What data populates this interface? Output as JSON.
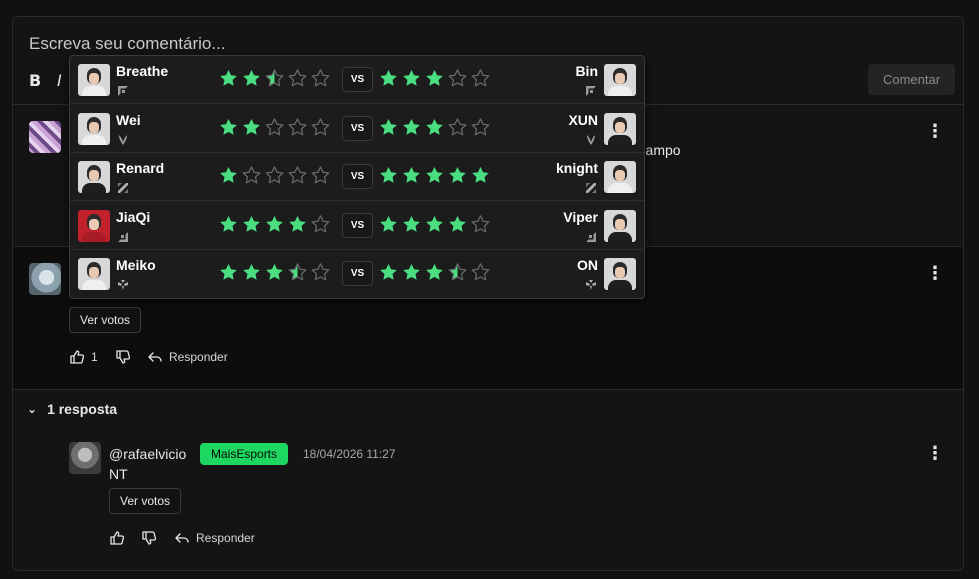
{
  "composer": {
    "placeholder": "Escreva seu comentário...",
    "bold_label": "B",
    "italic_label": "I",
    "submit_label": "Comentar"
  },
  "comments": [
    {
      "text_fragment": "m campo"
    },
    {
      "votes_label": "Ver votos",
      "likes": "1",
      "reply_label": "Responder"
    }
  ],
  "replies": {
    "toggle_label": "1 resposta",
    "items": [
      {
        "user": "@rafaelvicio",
        "badge": "MaisEsports",
        "timestamp": "18/04/2026 11:27",
        "text": "NT",
        "votes_label": "Ver votos",
        "reply_label": "Responder"
      }
    ]
  },
  "votes_popup": {
    "vs_label": "VS",
    "matchups": [
      {
        "left": {
          "name": "Breathe",
          "role": "top",
          "rating": 2.5
        },
        "right": {
          "name": "Bin",
          "role": "top",
          "rating": 3
        }
      },
      {
        "left": {
          "name": "Wei",
          "role": "jungle",
          "rating": 2
        },
        "right": {
          "name": "XUN",
          "role": "jungle",
          "rating": 3
        }
      },
      {
        "left": {
          "name": "Renard",
          "role": "mid",
          "rating": 1
        },
        "right": {
          "name": "knight",
          "role": "mid",
          "rating": 5
        }
      },
      {
        "left": {
          "name": "JiaQi",
          "role": "bot",
          "rating": 4
        },
        "right": {
          "name": "Viper",
          "role": "bot",
          "rating": 4
        }
      },
      {
        "left": {
          "name": "Meiko",
          "role": "support",
          "rating": 3.5
        },
        "right": {
          "name": "ON",
          "role": "support",
          "rating": 3.5
        }
      }
    ]
  },
  "colors": {
    "star_filled": "#4ade80",
    "star_empty": "#6b6b6b",
    "badge": "#1ed760"
  }
}
